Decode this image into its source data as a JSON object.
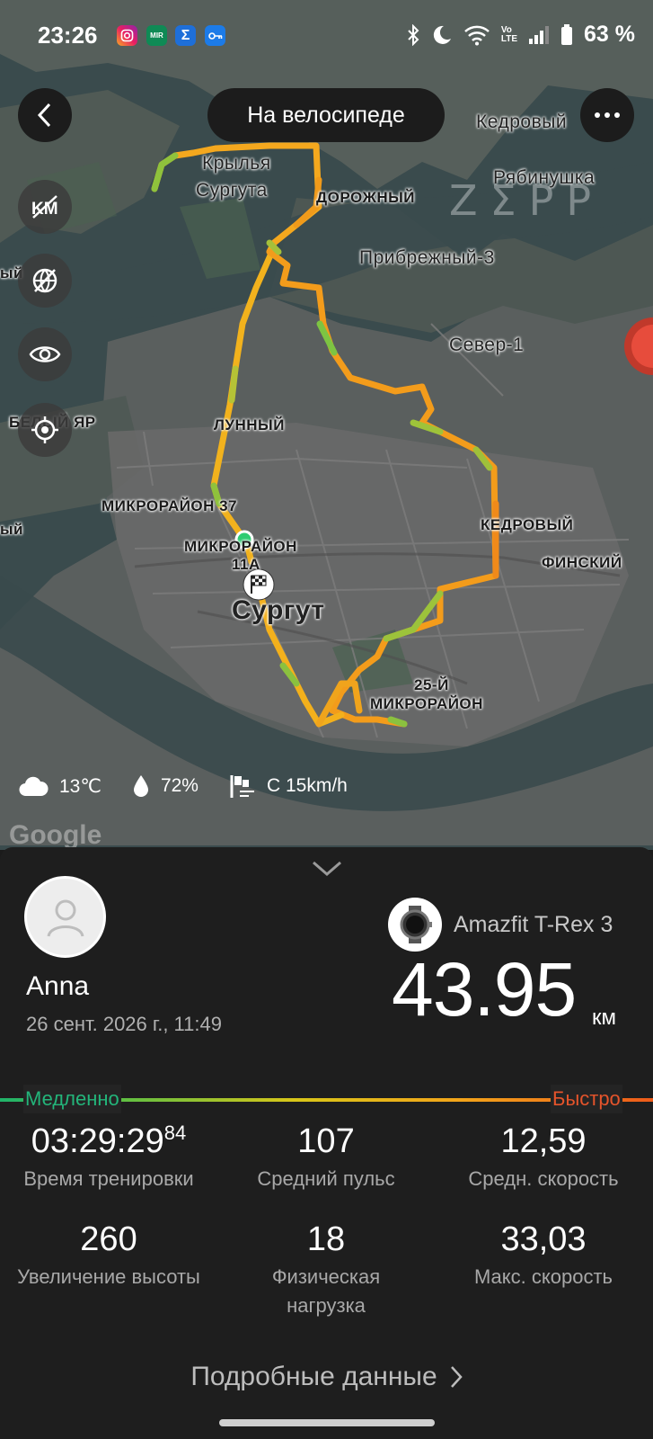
{
  "status_bar": {
    "time": "23:26",
    "icons": [
      "instagram-icon",
      "mir-pay-icon",
      "sigma-app-icon",
      "key-app-icon",
      "bluetooth-icon",
      "do-not-disturb-moon-icon",
      "wifi-icon",
      "volte-icon",
      "signal-icon",
      "battery-icon"
    ],
    "battery": "63 %",
    "volte_top": "Vo",
    "volte_bottom": "LTE",
    "app_mir_label": "MIR"
  },
  "top_nav": {
    "activity_type": "На велосипеде"
  },
  "map": {
    "watermark": "ZΣPP",
    "labels": {
      "kedrovy_top": "Кедровый",
      "ryabinushka": "Рябинушка",
      "krylya_1": "Крылья",
      "krylya_2": "Сургута",
      "dorozhny": "ДОРОЖНЫЙ",
      "pribrezhny": "Прибрежный-3",
      "sever": "Север-1",
      "belyi_yar": "БЕЛЫЙ ЯР",
      "lunny": "ЛУННЫЙ",
      "mikro37": "МИКРОРАЙОН 37",
      "mikro11_1": "МИКРОРАЙОН",
      "mikro11_2": "11А",
      "surgut": "Сургут",
      "kedrovy": "КЕДРОВЫЙ",
      "finsky": "ФИНСКИЙ",
      "mikro25_1": "25-Й",
      "mikro25_2": "МИКРОРАЙОН",
      "left_edge_1": "ый",
      "left_edge_2": "ый"
    },
    "weather": {
      "temperature": "13℃",
      "humidity": "72%",
      "wind": "С 15km/h"
    },
    "google_logo": "Google"
  },
  "summary": {
    "user_name": "Anna",
    "date": "26 сент. 2026 г., 11:49",
    "device_name": "Amazfit T-Rex 3",
    "distance": "43.95",
    "distance_unit": "км",
    "speed_legend": {
      "slow": "Медленно",
      "fast": "Быстро",
      "colors": [
        "#20b36a",
        "#d8c619",
        "#f2a51a",
        "#ee5b1a"
      ]
    },
    "stats": [
      {
        "value": "03:29:29",
        "value_sup": "84",
        "label": "Время тренировки"
      },
      {
        "value": "107",
        "label": "Средний пульс"
      },
      {
        "value": "12,59",
        "label": "Средн. скорость"
      },
      {
        "value": "260",
        "label": "Увеличение высоты"
      },
      {
        "value": "18",
        "label": "Физическая нагрузка"
      },
      {
        "value": "33,03",
        "label": "Макс. скорость"
      }
    ],
    "details_link": "Подробные данные"
  }
}
